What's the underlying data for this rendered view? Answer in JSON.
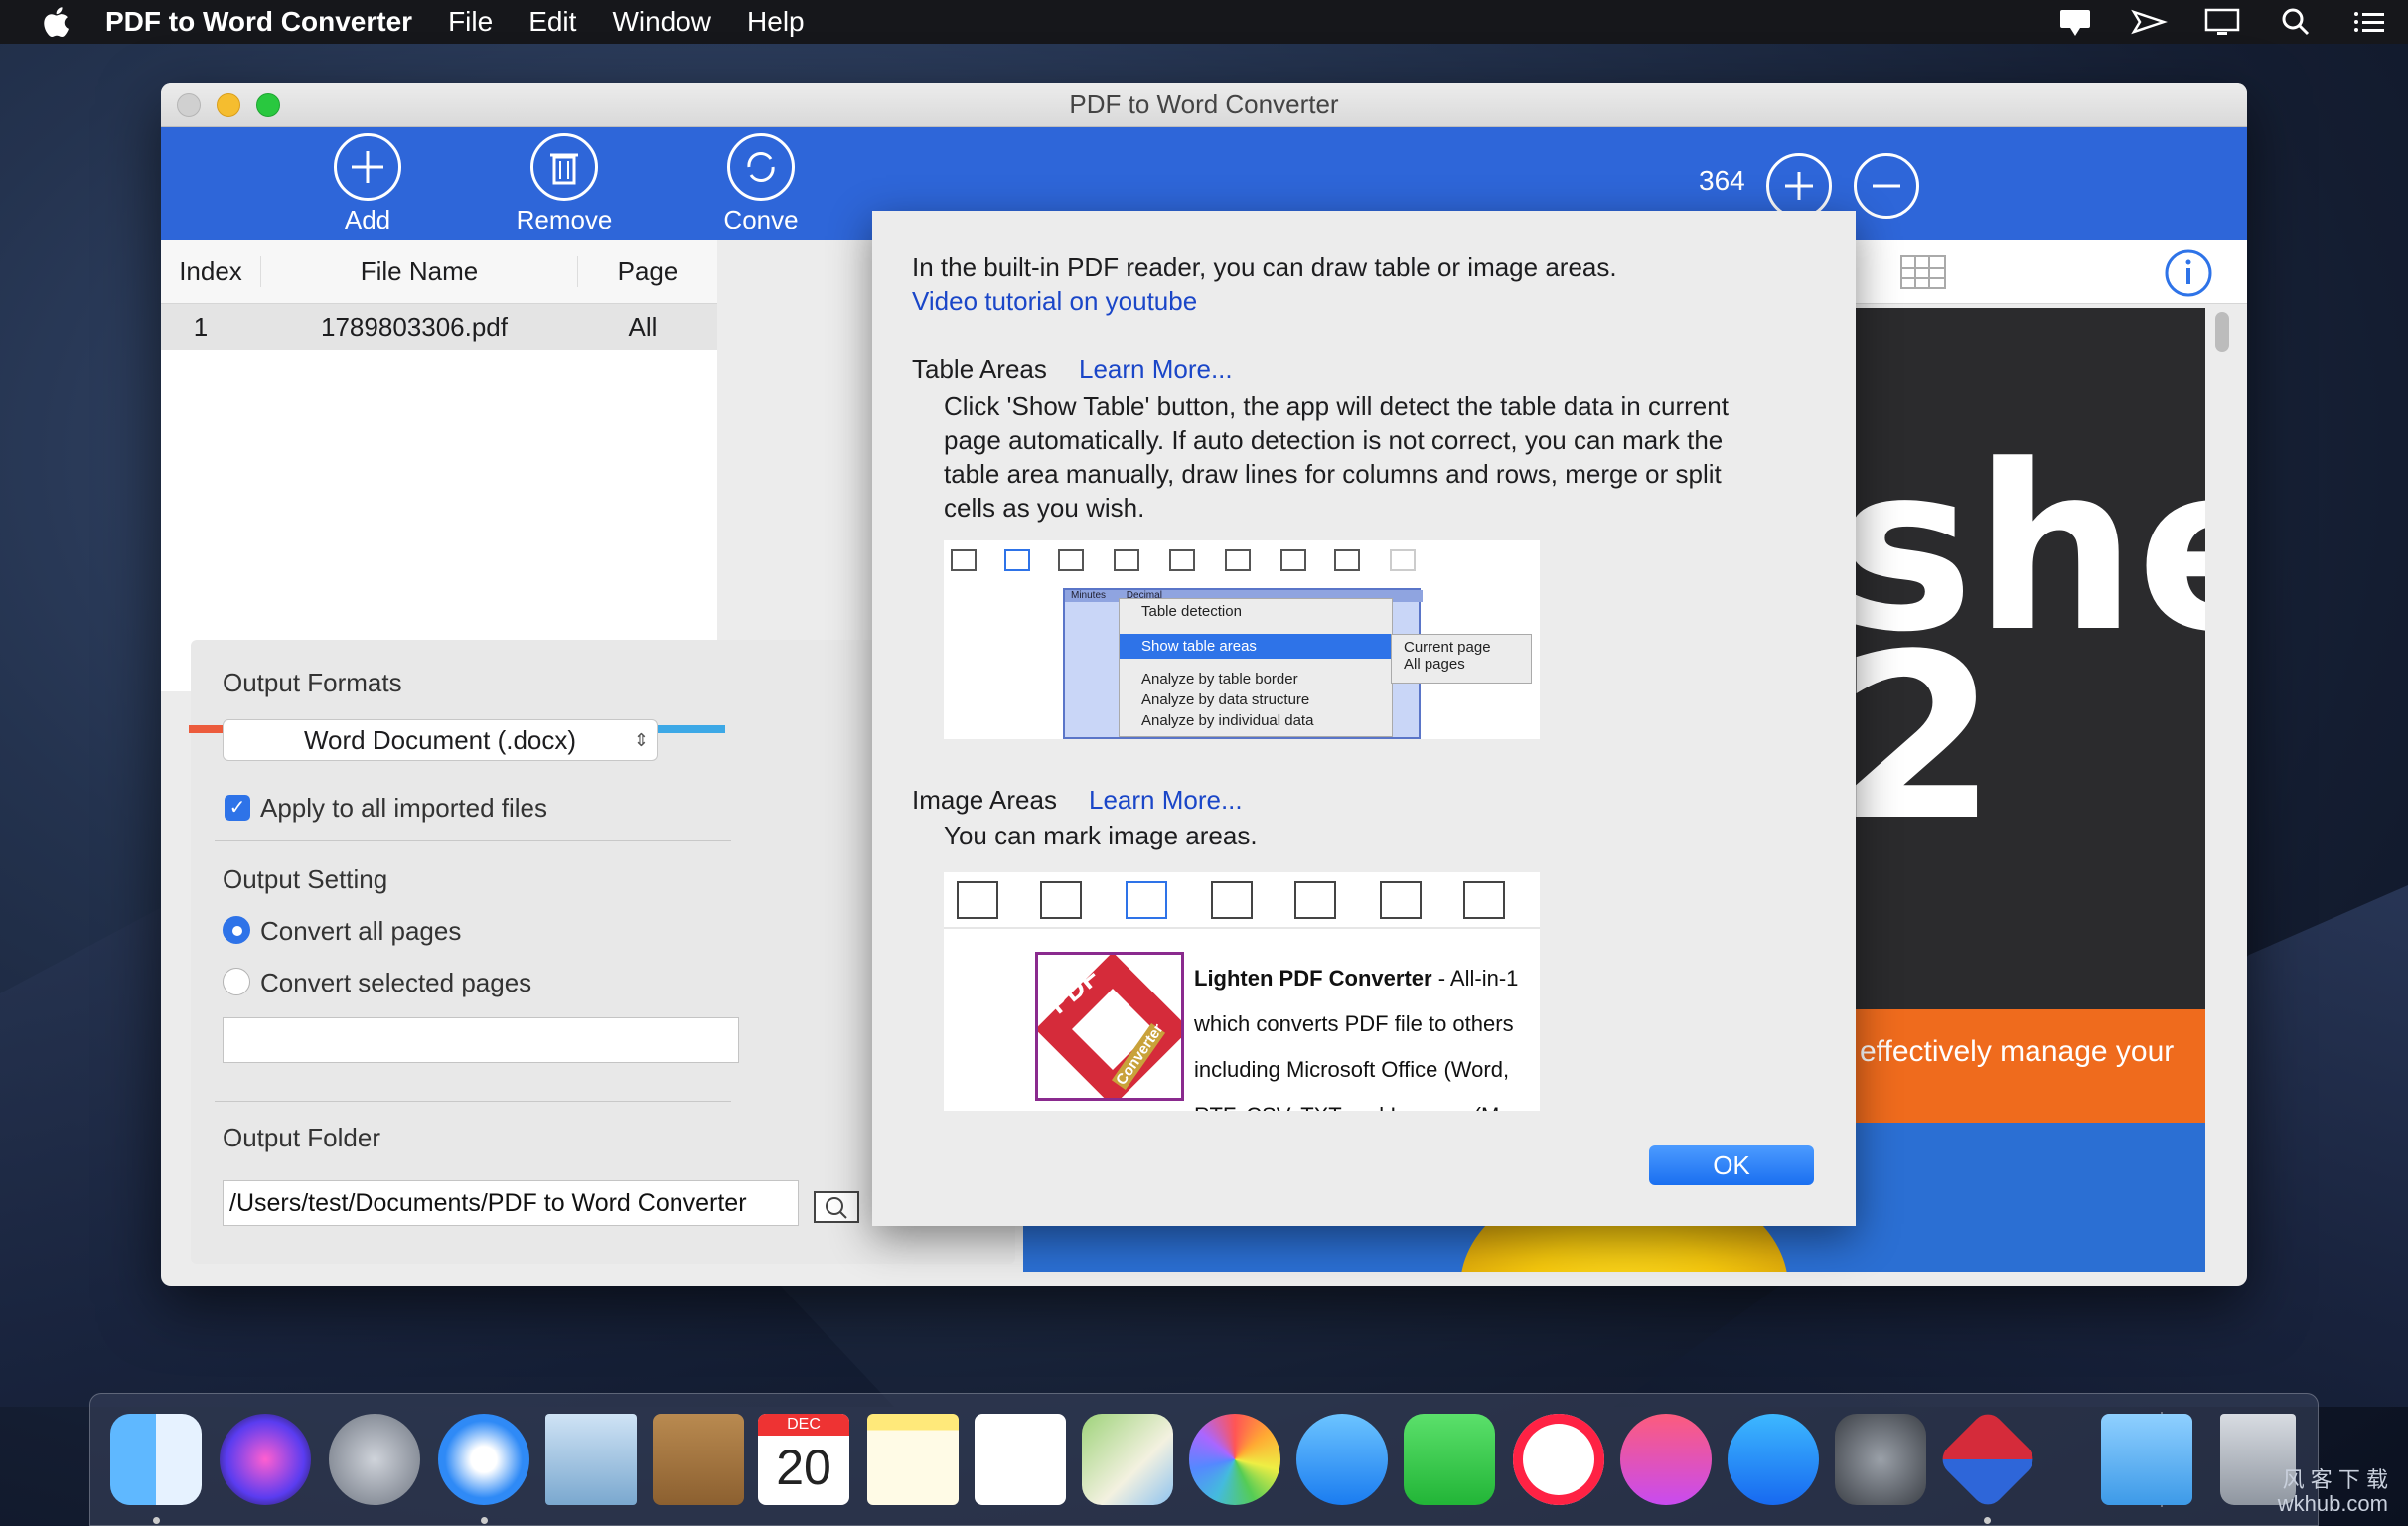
{
  "menubar": {
    "app_name": "PDF to Word Converter",
    "items": [
      "File",
      "Edit",
      "Window",
      "Help"
    ]
  },
  "window": {
    "title": "PDF to Word Converter",
    "toolbar": {
      "add": "Add",
      "remove": "Remove",
      "convert": "Conve"
    },
    "zoom": "364"
  },
  "file_list": {
    "headers": {
      "index": "Index",
      "file_name": "File Name",
      "page": "Page"
    },
    "rows": [
      {
        "index": "1",
        "file_name": "1789803306.pdf",
        "page": "All"
      }
    ]
  },
  "settings": {
    "output_formats_label": "Output Formats",
    "format_value": "Word Document (.docx)",
    "apply_all": "Apply to all imported files",
    "output_setting_label": "Output Setting",
    "convert_all": "Convert all pages",
    "convert_selected": "Convert selected pages",
    "output_folder_label": "Output Folder",
    "output_folder_value": "/Users/test/Documents/PDF to Word Converter"
  },
  "preview": {
    "text_line1": "shell",
    "text_line2": "2",
    "banner": "effectively manage your"
  },
  "dialog": {
    "intro": "In the built-in PDF reader, you can draw table or image areas.",
    "video_link": "Video tutorial on youtube",
    "table_title": "Table Areas",
    "learn_more": "Learn More...",
    "table_desc_1": "Click 'Show Table' button, the app will detect the table data in current",
    "table_desc_2": "page automatically. If auto detection is not correct, you can mark the",
    "table_desc_3": "table area manually, draw lines for columns and rows, merge or split",
    "table_desc_4": "cells as you wish.",
    "menu": {
      "table_detection": "Table detection",
      "show_table_areas": "Show table areas",
      "analyze_border": "Analyze by table border",
      "analyze_structure": "Analyze by data structure",
      "analyze_individual": "Analyze by individual data",
      "current_page": "Current page",
      "all_pages": "All pages",
      "col_minutes": "Minutes",
      "col_decimal": "Decimal"
    },
    "image_title": "Image Areas",
    "image_desc": "You can mark image areas.",
    "sample_title": "Lighten PDF Converter",
    "sample_title_suffix": " - All-in-1",
    "sample_line2": "which converts PDF file to others",
    "sample_line3": "including Microsoft Office (Word,",
    "sample_line4": "RTF, CSV, TXT and Images. (Mac vers",
    "logo_pdf": "PDF",
    "logo_converter": "Converter",
    "ok": "OK"
  },
  "dock": {
    "calendar_month": "DEC",
    "calendar_day": "20"
  },
  "watermark": {
    "line1": "风 客 下 载",
    "line2": "wkhub.com"
  },
  "colors": {
    "toolbar_blue": "#2e66d9",
    "accent": "#2e73e8",
    "orange": "#ef6b1d"
  }
}
